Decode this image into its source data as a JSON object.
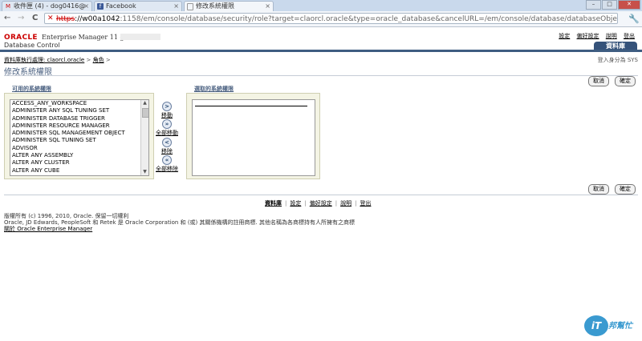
{
  "browser": {
    "tabs": [
      {
        "title": "收件匣 (4) - dog0416@",
        "icon": "gmail-icon",
        "icon_glyph": "M"
      },
      {
        "title": "Facebook",
        "icon": "facebook-icon",
        "icon_glyph": "f"
      },
      {
        "title": "修改系統權限",
        "icon": "page-icon",
        "icon_glyph": ""
      }
    ],
    "window_buttons": [
      "–",
      "□",
      "✕"
    ],
    "nav": {
      "back": "←",
      "forward": "→",
      "reload": "C"
    },
    "address": {
      "scheme": "https",
      "host": "://w00a1042",
      "path": ":1158/em/console/database/security/role?target=claorcl.oracle&type=oracle_database&cancelURL=/em/console/database/databaseObjec"
    }
  },
  "header": {
    "logo": "ORACLE",
    "product": "Enterprise Manager 11 g",
    "subtitle": "Database Control",
    "links": [
      "設定",
      "偏好設定",
      "說明",
      "登出"
    ],
    "active_tab": "資料庫"
  },
  "breadcrumb": {
    "items": [
      "資料庫執行處理: claorcl.oracle",
      "角色"
    ],
    "separator": ">"
  },
  "logged_in": "登入身分為 SYS",
  "page_title": "修改系統權限",
  "buttons": {
    "cancel": "取消",
    "ok": "確定"
  },
  "shuttle": {
    "available_label": "可用的系統權限",
    "selected_label": "選取的系統權限",
    "available_items": [
      "ACCESS_ANY_WORKSPACE",
      "ADMINISTER ANY SQL TUNING SET",
      "ADMINISTER DATABASE TRIGGER",
      "ADMINISTER RESOURCE MANAGER",
      "ADMINISTER SQL MANAGEMENT OBJECT",
      "ADMINISTER SQL TUNING SET",
      "ADVISOR",
      "ALTER ANY ASSEMBLY",
      "ALTER ANY CLUSTER",
      "ALTER ANY CUBE"
    ],
    "move": "移動",
    "move_all": "全部移動",
    "remove": "移除",
    "remove_all": "全部移除",
    "move_glyph": ">",
    "move_all_glyph": "»",
    "remove_glyph": "<",
    "remove_all_glyph": "«"
  },
  "footer": {
    "links": [
      "資料庫",
      "設定",
      "偏好設定",
      "說明",
      "登出"
    ],
    "copyright": "版權所有 (c) 1996, 2010, Oracle. 保留一切權利",
    "trademark": "Oracle, JD Edwards, PeopleSoft 和 Retek 是 Oracle Corporation 和 (或) 其關係機構的註冊商標. 其他名稱為各商標持有人所擁有之商標",
    "about": "關於 Oracle Enterprise Manager"
  },
  "watermark": {
    "badge": "iT",
    "text": "邦幫忙"
  }
}
